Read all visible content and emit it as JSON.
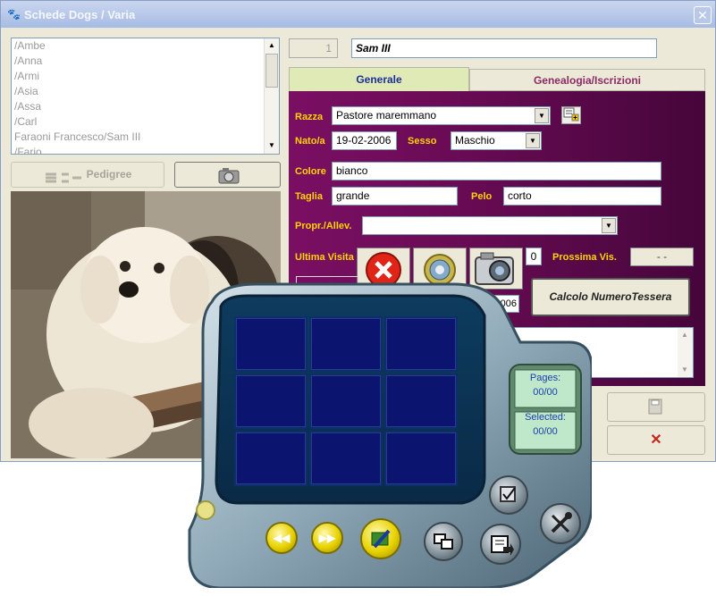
{
  "window": {
    "title": "Schede Dogs / Varia",
    "close_glyph": "✕",
    "app_icon": "paw-icon"
  },
  "dog_list": {
    "items": [
      "/Ambe",
      "/Anna",
      "/Armi",
      "/Asia",
      "/Assa",
      "/Carl",
      "Faraoni Francesco/Sam III",
      "/Fario"
    ],
    "scroll_up": "▲",
    "scroll_down": "▼"
  },
  "left_buttons": {
    "pedigree_label": "Pedigree",
    "pedigree_icon": "tree-icon",
    "camera_icon": "camera-icon"
  },
  "record": {
    "number": "1",
    "name": "Sam III"
  },
  "tabs": {
    "generale": "Generale",
    "genealogia": "Genealogia/Iscrizioni"
  },
  "form": {
    "razza_label": "Razza",
    "razza_value": "Pastore maremmano",
    "nato_label": "Nato/a",
    "nato_value": "19-02-2006",
    "sesso_label": "Sesso",
    "sesso_value": "Maschio",
    "colore_label": "Colore",
    "colore_value": "bianco",
    "taglia_label": "Taglia",
    "taglia_value": "grande",
    "pelo_label": "Pelo",
    "pelo_value": "corto",
    "propr_label": "Propr./Allev.",
    "propr_value": "",
    "ultima_visita_label": "Ultima Visita",
    "visit_count": "0",
    "prossima_label": "Prossima Vis.",
    "prossima_value": "- -",
    "date_partial": "006",
    "calcolo_label": "Calcolo NumeroTessera",
    "dropdown_glyph": "▼"
  },
  "bottom_buttons": {
    "save_icon": "floppy-icon",
    "cancel_glyph": "✕"
  },
  "viewer": {
    "pages_label": "Pages:",
    "pages_value": "00/00",
    "selected_label": "Selected:",
    "selected_value": "00/00",
    "prev_glyph": "◀◀",
    "next_glyph": "▶▶"
  },
  "colors": {
    "panel": "#7b0f63",
    "label_yellow": "#ffd400",
    "tab_active": "#dfeab6",
    "cell_blue": "#0b1570"
  }
}
